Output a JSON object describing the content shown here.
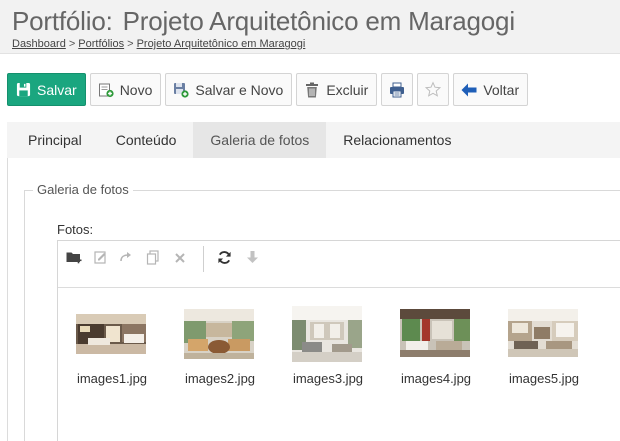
{
  "header": {
    "section": "Portfólio:",
    "title": "Projeto Arquitetônico em Maragogi",
    "breadcrumb": [
      "Dashboard",
      "Portfólios",
      "Projeto Arquitetônico em Maragogi"
    ],
    "breadcrumb_sep": ">"
  },
  "toolbar": {
    "save": "Salvar",
    "new": "Novo",
    "save_new": "Salvar e Novo",
    "delete": "Excluir",
    "back": "Voltar",
    "print_icon": "print-icon",
    "favorite_icon": "star-icon"
  },
  "tabs": [
    {
      "label": "Principal",
      "active": false
    },
    {
      "label": "Conteúdo",
      "active": false
    },
    {
      "label": "Galeria de fotos",
      "active": true
    },
    {
      "label": "Relacionamentos",
      "active": false
    }
  ],
  "gallery": {
    "legend": "Galeria de fotos",
    "field_label": "Fotos:",
    "toolbar_icons": [
      "new-folder-icon",
      "rename-icon",
      "redo-icon",
      "copy-icon",
      "delete-icon",
      "refresh-icon",
      "download-icon"
    ],
    "files": [
      {
        "name": "images1.jpg"
      },
      {
        "name": "images2.jpg"
      },
      {
        "name": "images3.jpg"
      },
      {
        "name": "images4.jpg"
      },
      {
        "name": "images5.jpg"
      }
    ]
  },
  "colors": {
    "primary_button": "#1aa67f",
    "back_arrow": "#1f5fb8",
    "page_header_bg": "#f2f2f2"
  }
}
